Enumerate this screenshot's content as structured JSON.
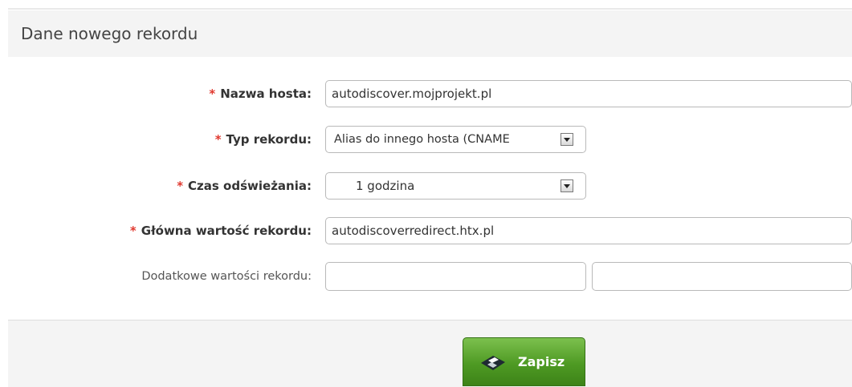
{
  "panel": {
    "title": "Dane nowego rekordu"
  },
  "form": {
    "required_mark": "*",
    "hostname": {
      "label": "Nazwa hosta:",
      "value": "autodiscover.mojprojekt.pl"
    },
    "record_type": {
      "label": "Typ rekordu:",
      "value": "Alias do innego hosta (CNAME"
    },
    "ttl": {
      "label": "Czas odświeżania:",
      "value": "1 godzina"
    },
    "main_value": {
      "label": "Główna wartość rekordu:",
      "value": "autodiscoverredirect.htx.pl"
    },
    "extra_values": {
      "label": "Dodatkowe wartości rekordu:",
      "value1": "",
      "value2": ""
    }
  },
  "actions": {
    "save_label": "Zapisz"
  },
  "colors": {
    "required": "#e0382e",
    "save_button": "#4e9a23",
    "panel_bg": "#f4f4f4"
  },
  "icons": {
    "save": "floppy-disk-icon",
    "dropdown": "chevron-down-icon"
  }
}
